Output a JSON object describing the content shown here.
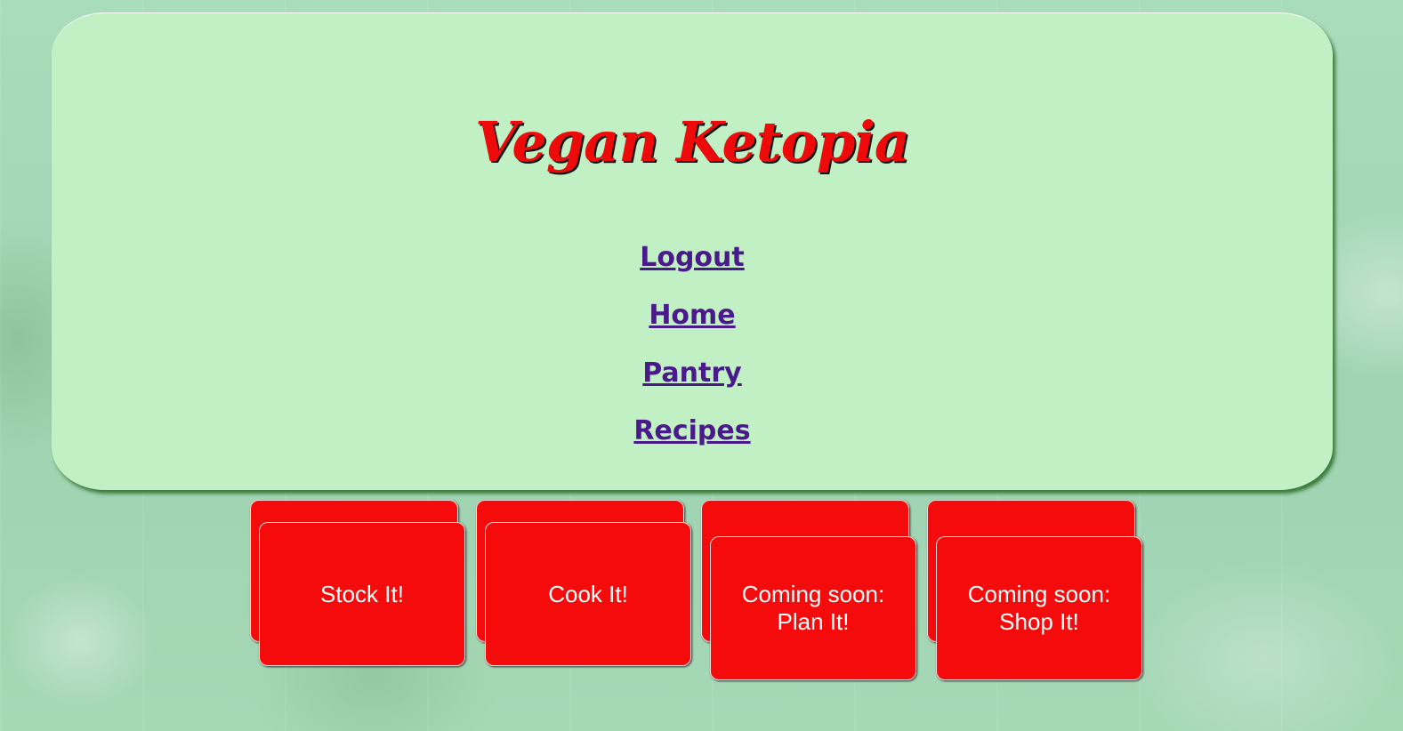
{
  "header": {
    "title": "Vegan Ketopia",
    "title_color": "#ee0a0a",
    "panel_color": "#c1f0c4"
  },
  "nav": {
    "links": [
      {
        "label": "Logout"
      },
      {
        "label": "Home"
      },
      {
        "label": "Pantry"
      },
      {
        "label": "Recipes"
      }
    ],
    "link_color": "#4a1a8a"
  },
  "cards": [
    {
      "label": "Stock It!"
    },
    {
      "label": "Cook It!"
    },
    {
      "label": "Coming soon:\nPlan It!"
    },
    {
      "label": "Coming soon:\nShop It!"
    }
  ],
  "card_color": "#f50b0b"
}
